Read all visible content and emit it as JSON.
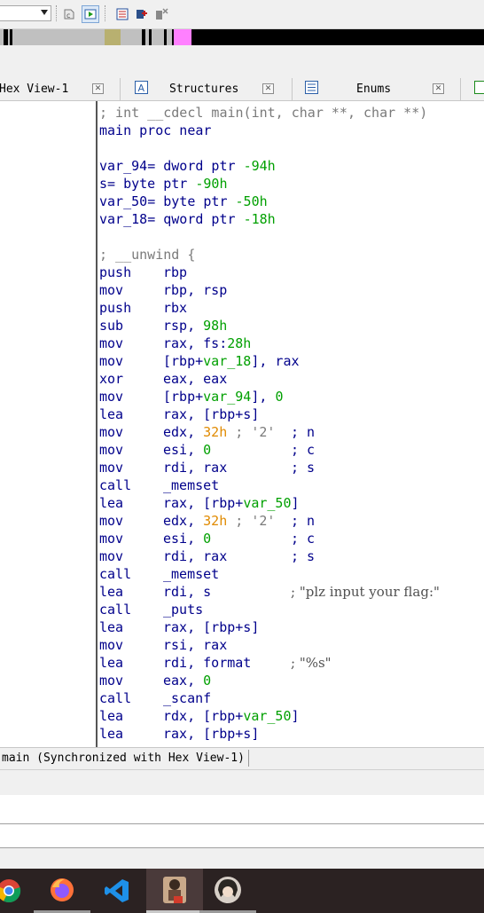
{
  "toolbar": {
    "buttons": [
      "c-tag-icon",
      "run-icon",
      "segments-icon",
      "add-breakpoint-icon",
      "delete-breakpoint-icon"
    ]
  },
  "tabs": [
    {
      "label": "Hex View-1",
      "icon": "hex-icon"
    },
    {
      "label": "Structures",
      "icon": "structures-icon",
      "icon_glyph": "A"
    },
    {
      "label": "Enums",
      "icon": "enums-icon"
    }
  ],
  "disasm": {
    "header_comment": "; int __cdecl main(int, char **, char **)",
    "proc_decl": "main proc near",
    "vars": [
      {
        "name": "var_94",
        "sep": "=",
        "type": "dword ptr",
        "offset": "-94h"
      },
      {
        "name": "s",
        "sep": "=",
        "type": "byte ptr",
        "offset": "-90h"
      },
      {
        "name": "var_50",
        "sep": "=",
        "type": "byte ptr",
        "offset": "-50h"
      },
      {
        "name": "var_18",
        "sep": "=",
        "type": "qword ptr",
        "offset": "-18h"
      }
    ],
    "unwind_comment": "; __unwind {",
    "instructions": [
      {
        "mnemonic": "push",
        "operands": "rbp"
      },
      {
        "mnemonic": "mov",
        "operands": "rbp, rsp"
      },
      {
        "mnemonic": "push",
        "operands": "rbx"
      },
      {
        "mnemonic": "sub",
        "operands": "rsp, 98h"
      },
      {
        "mnemonic": "mov",
        "operands": "rax, fs:28h"
      },
      {
        "mnemonic": "mov",
        "operands": "[rbp+var_18], rax"
      },
      {
        "mnemonic": "xor",
        "operands": "eax, eax"
      },
      {
        "mnemonic": "mov",
        "operands": "[rbp+var_94], 0"
      },
      {
        "mnemonic": "lea",
        "operands": "rax, [rbp+s]"
      },
      {
        "mnemonic": "mov",
        "operands": "edx, 32h ; '2'",
        "comment": "; n"
      },
      {
        "mnemonic": "mov",
        "operands": "esi, 0",
        "comment": "; c"
      },
      {
        "mnemonic": "mov",
        "operands": "rdi, rax",
        "comment": "; s"
      },
      {
        "mnemonic": "call",
        "operands": "_memset"
      },
      {
        "mnemonic": "lea",
        "operands": "rax, [rbp+var_50]"
      },
      {
        "mnemonic": "mov",
        "operands": "edx, 32h ; '2'",
        "comment": "; n"
      },
      {
        "mnemonic": "mov",
        "operands": "esi, 0",
        "comment": "; c"
      },
      {
        "mnemonic": "mov",
        "operands": "rdi, rax",
        "comment": "; s"
      },
      {
        "mnemonic": "call",
        "operands": "_memset"
      },
      {
        "mnemonic": "lea",
        "operands": "rdi, s",
        "comment": "; \"plz input your flag:\""
      },
      {
        "mnemonic": "call",
        "operands": "_puts"
      },
      {
        "mnemonic": "lea",
        "operands": "rax, [rbp+s]"
      },
      {
        "mnemonic": "mov",
        "operands": "rsi, rax"
      },
      {
        "mnemonic": "lea",
        "operands": "rdi, format",
        "comment": "; \"%s\""
      },
      {
        "mnemonic": "mov",
        "operands": "eax, 0"
      },
      {
        "mnemonic": "call",
        "operands": "_scanf"
      },
      {
        "mnemonic": "lea",
        "operands": "rdx, [rbp+var_50]"
      },
      {
        "mnemonic": "lea",
        "operands": "rax, [rbp+s]"
      }
    ]
  },
  "status": {
    "label": "main (Synchronized with Hex View-1)"
  },
  "taskbar": {
    "apps": [
      {
        "name": "chrome-icon"
      },
      {
        "name": "firefox-icon"
      },
      {
        "name": "visual-studio-icon"
      },
      {
        "name": "ida-icon"
      },
      {
        "name": "user-avatar-icon"
      }
    ]
  },
  "colors": {
    "code_text": "#00008b",
    "comment": "#7a7a7a",
    "number": "#00a000",
    "hex_literal": "#e08a00",
    "nav_band_code": "#c0c0c0",
    "nav_band_data": "#b8b070",
    "nav_band_extern": "#ff80ff",
    "taskbar_bg": "#2b2222"
  }
}
